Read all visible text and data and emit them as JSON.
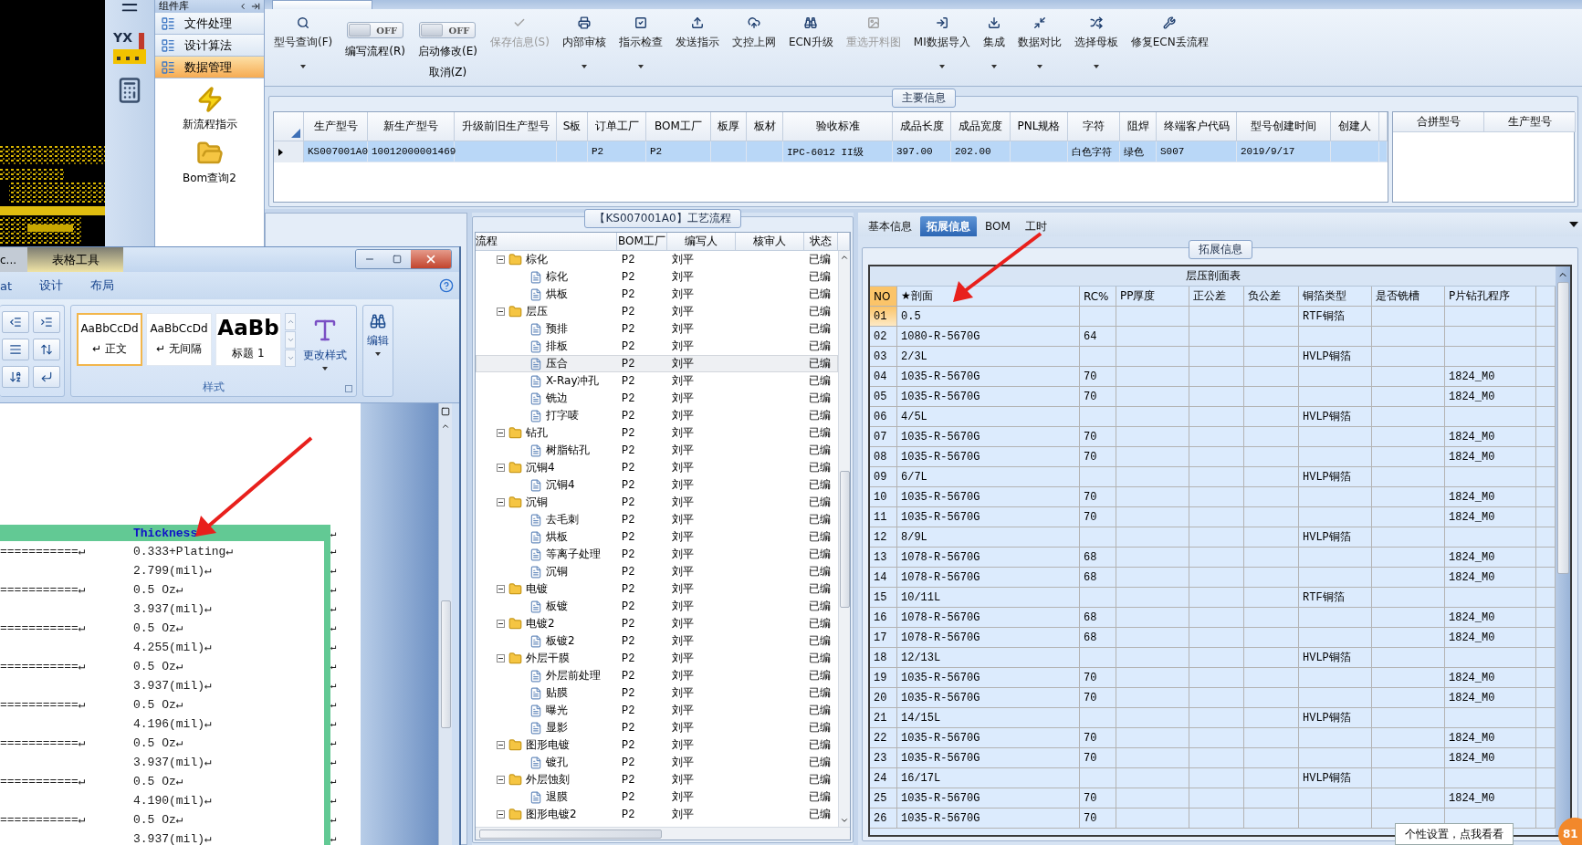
{
  "side": {
    "logo_text": "YX"
  },
  "nav": {
    "header": "组件库",
    "items": [
      {
        "label": "文件处理",
        "selected": false
      },
      {
        "label": "设计算法",
        "selected": false
      },
      {
        "label": "数据管理",
        "selected": true
      }
    ],
    "tools": [
      "新流程指示",
      "Bom查询2"
    ]
  },
  "toolbar": [
    {
      "kind": "button",
      "label": "型号查询(F)",
      "dropdown": true,
      "disabled": false
    },
    {
      "kind": "toggle",
      "switch_text": "OFF",
      "on": false,
      "label": "编写流程(R)"
    },
    {
      "kind": "toggle",
      "switch_text": "OFF",
      "on": false,
      "label": "启动修改(E)",
      "label2": "取消(Z)"
    },
    {
      "kind": "button",
      "label": "保存信息(S)",
      "dropdown": false,
      "disabled": true
    },
    {
      "kind": "button",
      "label": "内部审核",
      "dropdown": true,
      "disabled": false
    },
    {
      "kind": "button",
      "label": "指示检查",
      "dropdown": true,
      "disabled": false
    },
    {
      "kind": "button",
      "label": "发送指示",
      "dropdown": false,
      "disabled": false
    },
    {
      "kind": "button",
      "label": "文控上网",
      "dropdown": false,
      "disabled": false
    },
    {
      "kind": "button",
      "label": "ECN升级",
      "dropdown": false,
      "disabled": false
    },
    {
      "kind": "button",
      "label": "重选开料图",
      "dropdown": false,
      "disabled": true
    },
    {
      "kind": "button",
      "label": "MI数据导入",
      "dropdown": true,
      "disabled": false
    },
    {
      "kind": "button",
      "label": "集成",
      "dropdown": true,
      "disabled": false
    },
    {
      "kind": "button",
      "label": "数据对比",
      "dropdown": true,
      "disabled": false
    },
    {
      "kind": "button",
      "label": "选择母板",
      "dropdown": true,
      "disabled": false
    },
    {
      "kind": "button",
      "label": "修复ECN丢流程",
      "dropdown": false,
      "disabled": false
    }
  ],
  "main_info": {
    "title": "主要信息",
    "columns": [
      "生产型号",
      "新生产型号",
      "升级前旧生产型号",
      "S板",
      "订单工厂",
      "BOM工厂",
      "板厚",
      "板材",
      "验收标准",
      "成品长度",
      "成品宽度",
      "PNL规格",
      "字符",
      "阻焊",
      "终端客户代码",
      "型号创建时间",
      "创建人"
    ],
    "rows": [
      {
        "selected": true,
        "cells": [
          "KS007001A0",
          "10012000001469",
          null,
          null,
          "P2",
          "P2",
          null,
          null,
          "IPC-6012 II级",
          "397.00",
          "202.00",
          null,
          "白色字符",
          "绿色",
          "S007",
          "2019/9/17",
          null
        ]
      }
    ],
    "merge_columns": [
      "合拼型号",
      "生产型号"
    ]
  },
  "process": {
    "title": "【KS007001A0】工艺流程",
    "columns": [
      "流程",
      "BOM工厂",
      "编写人",
      "核审人",
      "状态"
    ],
    "tree": [
      {
        "kind": "folder",
        "name": "棕化",
        "bom": "P2",
        "writer": "刘平",
        "status": "已编",
        "expanded": true,
        "selected": false,
        "children": [
          {
            "kind": "step",
            "name": "棕化",
            "bom": "P2",
            "writer": "刘平",
            "status": "已编",
            "selected": false
          },
          {
            "kind": "step",
            "name": "烘板",
            "bom": "P2",
            "writer": "刘平",
            "status": "已编",
            "selected": false
          }
        ]
      },
      {
        "kind": "folder",
        "name": "层压",
        "bom": "P2",
        "writer": "刘平",
        "status": "已编",
        "expanded": true,
        "selected": false,
        "children": [
          {
            "kind": "step",
            "name": "预排",
            "bom": "P2",
            "writer": "刘平",
            "status": "已编",
            "selected": false
          },
          {
            "kind": "step",
            "name": "排板",
            "bom": "P2",
            "writer": "刘平",
            "status": "已编",
            "selected": false
          },
          {
            "kind": "step",
            "name": "压合",
            "bom": "P2",
            "writer": "刘平",
            "status": "已编",
            "selected": true
          },
          {
            "kind": "step",
            "name": "X-Ray冲孔",
            "bom": "P2",
            "writer": "刘平",
            "status": "已编",
            "selected": false
          },
          {
            "kind": "step",
            "name": "铣边",
            "bom": "P2",
            "writer": "刘平",
            "status": "已编",
            "selected": false
          },
          {
            "kind": "step",
            "name": "打字唛",
            "bom": "P2",
            "writer": "刘平",
            "status": "已编",
            "selected": false
          }
        ]
      },
      {
        "kind": "folder",
        "name": "钻孔",
        "bom": "P2",
        "writer": "刘平",
        "status": "已编",
        "expanded": true,
        "selected": false,
        "children": [
          {
            "kind": "step",
            "name": "树脂钻孔",
            "bom": "P2",
            "writer": "刘平",
            "status": "已编",
            "selected": false
          }
        ]
      },
      {
        "kind": "folder",
        "name": "沉铜4",
        "bom": "P2",
        "writer": "刘平",
        "status": "已编",
        "expanded": true,
        "selected": false,
        "children": [
          {
            "kind": "step",
            "name": "沉铜4",
            "bom": "P2",
            "writer": "刘平",
            "status": "已编",
            "selected": false
          }
        ]
      },
      {
        "kind": "folder",
        "name": "沉铜",
        "bom": "P2",
        "writer": "刘平",
        "status": "已编",
        "expanded": true,
        "selected": false,
        "children": [
          {
            "kind": "step",
            "name": "去毛刺",
            "bom": "P2",
            "writer": "刘平",
            "status": "已编",
            "selected": false
          },
          {
            "kind": "step",
            "name": "烘板",
            "bom": "P2",
            "writer": "刘平",
            "status": "已编",
            "selected": false
          },
          {
            "kind": "step",
            "name": "等离子处理",
            "bom": "P2",
            "writer": "刘平",
            "status": "已编",
            "selected": false
          },
          {
            "kind": "step",
            "name": "沉铜",
            "bom": "P2",
            "writer": "刘平",
            "status": "已编",
            "selected": false
          }
        ]
      },
      {
        "kind": "folder",
        "name": "电镀",
        "bom": "P2",
        "writer": "刘平",
        "status": "已编",
        "expanded": true,
        "selected": false,
        "children": [
          {
            "kind": "step",
            "name": "板镀",
            "bom": "P2",
            "writer": "刘平",
            "status": "已编",
            "selected": false
          }
        ]
      },
      {
        "kind": "folder",
        "name": "电镀2",
        "bom": "P2",
        "writer": "刘平",
        "status": "已编",
        "expanded": true,
        "selected": false,
        "children": [
          {
            "kind": "step",
            "name": "板镀2",
            "bom": "P2",
            "writer": "刘平",
            "status": "已编",
            "selected": false
          }
        ]
      },
      {
        "kind": "folder",
        "name": "外层干膜",
        "bom": "P2",
        "writer": "刘平",
        "status": "已编",
        "expanded": true,
        "selected": false,
        "children": [
          {
            "kind": "step",
            "name": "外层前处理",
            "bom": "P2",
            "writer": "刘平",
            "status": "已编",
            "selected": false
          },
          {
            "kind": "step",
            "name": "贴膜",
            "bom": "P2",
            "writer": "刘平",
            "status": "已编",
            "selected": false
          },
          {
            "kind": "step",
            "name": "曝光",
            "bom": "P2",
            "writer": "刘平",
            "status": "已编",
            "selected": false
          },
          {
            "kind": "step",
            "name": "显影",
            "bom": "P2",
            "writer": "刘平",
            "status": "已编",
            "selected": false
          }
        ]
      },
      {
        "kind": "folder",
        "name": "图形电镀",
        "bom": "P2",
        "writer": "刘平",
        "status": "已编",
        "expanded": true,
        "selected": false,
        "children": [
          {
            "kind": "step",
            "name": "镀孔",
            "bom": "P2",
            "writer": "刘平",
            "status": "已编",
            "selected": false
          }
        ]
      },
      {
        "kind": "folder",
        "name": "外层蚀刻",
        "bom": "P2",
        "writer": "刘平",
        "status": "已编",
        "expanded": true,
        "selected": false,
        "children": [
          {
            "kind": "step",
            "name": "退膜",
            "bom": "P2",
            "writer": "刘平",
            "status": "已编",
            "selected": false
          }
        ]
      },
      {
        "kind": "folder",
        "name": "图形电镀2",
        "bom": "P2",
        "writer": "刘平",
        "status": "已编",
        "expanded": true,
        "selected": false
      }
    ]
  },
  "detail": {
    "tabs": [
      {
        "label": "基本信息",
        "selected": false
      },
      {
        "label": "拓展信息",
        "selected": true
      },
      {
        "label": "BOM",
        "selected": false
      },
      {
        "label": "工时",
        "selected": false
      }
    ],
    "group_title": "拓展信息",
    "table_title": "层压剖面表",
    "columns": [
      "NO",
      "★剖面",
      "RC%",
      "PP厚度",
      "正公差",
      "负公差",
      "铜箔类型",
      "是否铣槽",
      "P片钻孔程序"
    ],
    "rows": [
      {
        "selected": true,
        "cells": [
          "01",
          "0.5",
          null,
          null,
          null,
          null,
          "RTF铜箔",
          null,
          null
        ]
      },
      {
        "selected": false,
        "cells": [
          "02",
          "1080-R-5670G",
          "64",
          null,
          null,
          null,
          null,
          null,
          null
        ]
      },
      {
        "selected": false,
        "cells": [
          "03",
          "2/3L",
          null,
          null,
          null,
          null,
          "HVLP铜箔",
          null,
          null
        ]
      },
      {
        "selected": false,
        "cells": [
          "04",
          "1035-R-5670G",
          "70",
          null,
          null,
          null,
          null,
          null,
          "1824_M0"
        ]
      },
      {
        "selected": false,
        "cells": [
          "05",
          "1035-R-5670G",
          "70",
          null,
          null,
          null,
          null,
          null,
          "1824_M0"
        ]
      },
      {
        "selected": false,
        "cells": [
          "06",
          "4/5L",
          null,
          null,
          null,
          null,
          "HVLP铜箔",
          null,
          null
        ]
      },
      {
        "selected": false,
        "cells": [
          "07",
          "1035-R-5670G",
          "70",
          null,
          null,
          null,
          null,
          null,
          "1824_M0"
        ]
      },
      {
        "selected": false,
        "cells": [
          "08",
          "1035-R-5670G",
          "70",
          null,
          null,
          null,
          null,
          null,
          "1824_M0"
        ]
      },
      {
        "selected": false,
        "cells": [
          "09",
          "6/7L",
          null,
          null,
          null,
          null,
          "HVLP铜箔",
          null,
          null
        ]
      },
      {
        "selected": false,
        "cells": [
          "10",
          "1035-R-5670G",
          "70",
          null,
          null,
          null,
          null,
          null,
          "1824_M0"
        ]
      },
      {
        "selected": false,
        "cells": [
          "11",
          "1035-R-5670G",
          "70",
          null,
          null,
          null,
          null,
          null,
          "1824_M0"
        ]
      },
      {
        "selected": false,
        "cells": [
          "12",
          "8/9L",
          null,
          null,
          null,
          null,
          "HVLP铜箔",
          null,
          null
        ]
      },
      {
        "selected": false,
        "cells": [
          "13",
          "1078-R-5670G",
          "68",
          null,
          null,
          null,
          null,
          null,
          "1824_M0"
        ]
      },
      {
        "selected": false,
        "cells": [
          "14",
          "1078-R-5670G",
          "68",
          null,
          null,
          null,
          null,
          null,
          "1824_M0"
        ]
      },
      {
        "selected": false,
        "cells": [
          "15",
          "10/11L",
          null,
          null,
          null,
          null,
          "RTF铜箔",
          null,
          null
        ]
      },
      {
        "selected": false,
        "cells": [
          "16",
          "1078-R-5670G",
          "68",
          null,
          null,
          null,
          null,
          null,
          "1824_M0"
        ]
      },
      {
        "selected": false,
        "cells": [
          "17",
          "1078-R-5670G",
          "68",
          null,
          null,
          null,
          null,
          null,
          "1824_M0"
        ]
      },
      {
        "selected": false,
        "cells": [
          "18",
          "12/13L",
          null,
          null,
          null,
          null,
          "HVLP铜箔",
          null,
          null
        ]
      },
      {
        "selected": false,
        "cells": [
          "19",
          "1035-R-5670G",
          "70",
          null,
          null,
          null,
          null,
          null,
          "1824_M0"
        ]
      },
      {
        "selected": false,
        "cells": [
          "20",
          "1035-R-5670G",
          "70",
          null,
          null,
          null,
          null,
          null,
          "1824_M0"
        ]
      },
      {
        "selected": false,
        "cells": [
          "21",
          "14/15L",
          null,
          null,
          null,
          null,
          "HVLP铜箔",
          null,
          null
        ]
      },
      {
        "selected": false,
        "cells": [
          "22",
          "1035-R-5670G",
          "70",
          null,
          null,
          null,
          null,
          null,
          "1824_M0"
        ]
      },
      {
        "selected": false,
        "cells": [
          "23",
          "1035-R-5670G",
          "70",
          null,
          null,
          null,
          null,
          null,
          "1824_M0"
        ]
      },
      {
        "selected": false,
        "cells": [
          "24",
          "16/17L",
          null,
          null,
          null,
          null,
          "HVLP铜箔",
          null,
          null
        ]
      },
      {
        "selected": false,
        "cells": [
          "25",
          "1035-R-5670G",
          "70",
          null,
          null,
          null,
          null,
          null,
          "1824_M0"
        ]
      },
      {
        "selected": false,
        "cells": [
          "26",
          "1035-R-5670G",
          "70",
          null,
          null,
          null,
          null,
          null,
          null
        ]
      }
    ]
  },
  "word": {
    "doc_tab": "c...",
    "context_tab": "表格工具",
    "ribbon_tabs": [
      "at",
      "设计",
      "布局"
    ],
    "styles": [
      {
        "sample": "AaBbCcDd",
        "name": "↵ 正文",
        "selected": true
      },
      {
        "sample": "AaBbCcDd",
        "name": "↵ 无间隔",
        "selected": false
      },
      {
        "sample": "AaBb",
        "name": "标题 1",
        "selected": false
      }
    ],
    "change_styles": "更改样式",
    "styles_group": "样式",
    "edit": "编辑",
    "doc": {
      "header": "Thickness",
      "header_end": "↵",
      "rows": [
        {
          "left": "===========↵",
          "value": "0.333+Plating↵",
          "end": "↵"
        },
        {
          "value": "2.799(mil)↵",
          "end": "↵"
        },
        {
          "left": "===========↵",
          "value": "0.5 Oz↵",
          "end": "↵"
        },
        {
          "value": "3.937(mil)↵",
          "end": "↵"
        },
        {
          "left": "===========↵",
          "value": "0.5 Oz↵",
          "end": "↵"
        },
        {
          "value": "4.255(mil)↵",
          "end": "↵"
        },
        {
          "left": "===========↵",
          "value": "0.5 Oz↵",
          "end": "↵"
        },
        {
          "value": "3.937(mil)↵",
          "end": "↵"
        },
        {
          "left": "===========↵",
          "value": "0.5 Oz↵",
          "end": "↵"
        },
        {
          "value": "4.196(mil)↵",
          "end": "↵"
        },
        {
          "left": "===========↵",
          "value": "0.5 Oz↵",
          "end": "↵"
        },
        {
          "value": "3.937(mil)↵",
          "end": "↵"
        },
        {
          "left": "===========↵",
          "value": "0.5 Oz↵",
          "end": "↵"
        },
        {
          "value": "4.190(mil)↵",
          "end": "↵"
        },
        {
          "left": "===========↵",
          "value": "0.5 Oz↵",
          "end": "↵"
        },
        {
          "value": "3.937(mil)↵",
          "end": "↵"
        }
      ]
    }
  },
  "tooltip": "个性设置，点我看看",
  "badge": "81"
}
